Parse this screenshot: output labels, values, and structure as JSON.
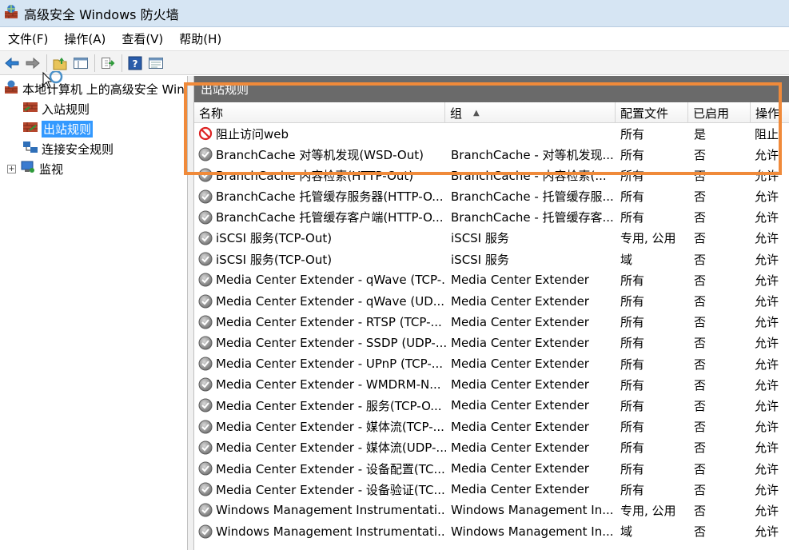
{
  "window": {
    "title": "高级安全 Windows 防火墙"
  },
  "menu": {
    "items": [
      "文件(F)",
      "操作(A)",
      "查看(V)",
      "帮助(H)"
    ]
  },
  "toolbar": {
    "buttons": [
      "back-icon",
      "forward-icon",
      "up-folder-icon",
      "show-hide-tree-icon",
      "export-icon",
      "help-icon",
      "properties-icon"
    ]
  },
  "tree": {
    "root": "本地计算机 上的高级安全 Windows 防火墙",
    "items": [
      "入站规则",
      "出站规则",
      "连接安全规则",
      "监视"
    ],
    "selected": "出站规则",
    "expander": "+"
  },
  "pane": {
    "title": "出站规则"
  },
  "columns": {
    "name": "名称",
    "group": "组",
    "profile": "配置文件",
    "enabled": "已启用",
    "action": "操作"
  },
  "rows": [
    {
      "icon": "block-icon",
      "name": "阻止访问web",
      "group": "",
      "profile": "所有",
      "enabled": "是",
      "action": "阻止"
    },
    {
      "icon": "rule-disabled-icon",
      "name": "BranchCache 对等机发现(WSD-Out)",
      "group": "BranchCache - 对等机发现...",
      "profile": "所有",
      "enabled": "否",
      "action": "允许"
    },
    {
      "icon": "rule-disabled-icon",
      "name": "BranchCache 内容检索(HTTP-Out)",
      "group": "BranchCache - 内容检索(...",
      "profile": "所有",
      "enabled": "否",
      "action": "允许"
    },
    {
      "icon": "rule-disabled-icon",
      "name": "BranchCache 托管缓存服务器(HTTP-O...",
      "group": "BranchCache - 托管缓存服...",
      "profile": "所有",
      "enabled": "否",
      "action": "允许"
    },
    {
      "icon": "rule-disabled-icon",
      "name": "BranchCache 托管缓存客户端(HTTP-O...",
      "group": "BranchCache - 托管缓存客...",
      "profile": "所有",
      "enabled": "否",
      "action": "允许"
    },
    {
      "icon": "rule-disabled-icon",
      "name": "iSCSI 服务(TCP-Out)",
      "group": "iSCSI 服务",
      "profile": "专用, 公用",
      "enabled": "否",
      "action": "允许"
    },
    {
      "icon": "rule-disabled-icon",
      "name": "iSCSI 服务(TCP-Out)",
      "group": "iSCSI 服务",
      "profile": "域",
      "enabled": "否",
      "action": "允许"
    },
    {
      "icon": "rule-disabled-icon",
      "name": "Media Center Extender - qWave (TCP-...",
      "group": "Media Center Extender",
      "profile": "所有",
      "enabled": "否",
      "action": "允许"
    },
    {
      "icon": "rule-disabled-icon",
      "name": "Media Center Extender - qWave (UD...",
      "group": "Media Center Extender",
      "profile": "所有",
      "enabled": "否",
      "action": "允许"
    },
    {
      "icon": "rule-disabled-icon",
      "name": "Media Center Extender - RTSP (TCP-...",
      "group": "Media Center Extender",
      "profile": "所有",
      "enabled": "否",
      "action": "允许"
    },
    {
      "icon": "rule-disabled-icon",
      "name": "Media Center Extender - SSDP (UDP-...",
      "group": "Media Center Extender",
      "profile": "所有",
      "enabled": "否",
      "action": "允许"
    },
    {
      "icon": "rule-disabled-icon",
      "name": "Media Center Extender - UPnP (TCP-...",
      "group": "Media Center Extender",
      "profile": "所有",
      "enabled": "否",
      "action": "允许"
    },
    {
      "icon": "rule-disabled-icon",
      "name": "Media Center Extender - WMDRM-N...",
      "group": "Media Center Extender",
      "profile": "所有",
      "enabled": "否",
      "action": "允许"
    },
    {
      "icon": "rule-disabled-icon",
      "name": "Media Center Extender - 服务(TCP-O...",
      "group": "Media Center Extender",
      "profile": "所有",
      "enabled": "否",
      "action": "允许"
    },
    {
      "icon": "rule-disabled-icon",
      "name": "Media Center Extender - 媒体流(TCP-...",
      "group": "Media Center Extender",
      "profile": "所有",
      "enabled": "否",
      "action": "允许"
    },
    {
      "icon": "rule-disabled-icon",
      "name": "Media Center Extender - 媒体流(UDP-...",
      "group": "Media Center Extender",
      "profile": "所有",
      "enabled": "否",
      "action": "允许"
    },
    {
      "icon": "rule-disabled-icon",
      "name": "Media Center Extender - 设备配置(TC...",
      "group": "Media Center Extender",
      "profile": "所有",
      "enabled": "否",
      "action": "允许"
    },
    {
      "icon": "rule-disabled-icon",
      "name": "Media Center Extender - 设备验证(TC...",
      "group": "Media Center Extender",
      "profile": "所有",
      "enabled": "否",
      "action": "允许"
    },
    {
      "icon": "rule-disabled-icon",
      "name": "Windows Management Instrumentati...",
      "group": "Windows Management In...",
      "profile": "专用, 公用",
      "enabled": "否",
      "action": "允许"
    },
    {
      "icon": "rule-disabled-icon",
      "name": "Windows Management Instrumentati...",
      "group": "Windows Management In...",
      "profile": "域",
      "enabled": "否",
      "action": "允许"
    }
  ],
  "colors": {
    "highlight": "#f08a3a",
    "selection": "#3399ff",
    "pane_header": "#6a6a6a"
  }
}
